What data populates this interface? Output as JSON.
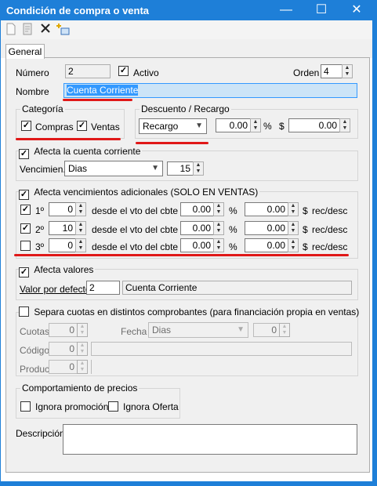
{
  "window": {
    "title": "Condición de compra o venta",
    "minimize": "—",
    "maximize": "☐",
    "close": "✕"
  },
  "toolbar": {
    "icons": [
      "new-doc-icon",
      "edit-doc-icon",
      "delete-icon",
      "add-field-icon"
    ]
  },
  "tabs": [
    {
      "label": "General"
    }
  ],
  "form": {
    "numero_label": "Número",
    "numero_value": "2",
    "activo_label": "Activo",
    "activo_checked": true,
    "orden_label": "Orden",
    "orden_value": "4",
    "nombre_label": "Nombre",
    "nombre_value": "Cuenta Corriente",
    "categoria": {
      "title": "Categoría",
      "compras_label": "Compras",
      "compras_checked": true,
      "ventas_label": "Ventas",
      "ventas_checked": true
    },
    "descuento": {
      "title": "Descuento / Recargo",
      "tipo": "Recargo",
      "porcentaje": "0.00",
      "pct_symbol": "%",
      "currency_symbol": "$",
      "monto": "0.00"
    },
    "afecta_cc": {
      "label": "Afecta la cuenta corriente",
      "checked": true,
      "venc_label": "Vencimien.",
      "venc_unit": "Dias",
      "venc_value": "15"
    },
    "vencimientos": {
      "label": "Afecta vencimientos adicionales (SOLO EN VENTAS)",
      "checked": true,
      "rows": [
        {
          "ord": "1º",
          "checked": true,
          "dias": "0",
          "desde": "desde el vto del cbte",
          "pct": "0.00",
          "pct_symbol": "%",
          "monto": "0.00",
          "currency_symbol": "$",
          "tipo": "rec/desc"
        },
        {
          "ord": "2º",
          "checked": true,
          "dias": "10",
          "desde": "desde el vto del cbte",
          "pct": "0.00",
          "pct_symbol": "%",
          "monto": "0.00",
          "currency_symbol": "$",
          "tipo": "rec/desc"
        },
        {
          "ord": "3º",
          "checked": false,
          "dias": "0",
          "desde": "desde el vto del cbte",
          "pct": "0.00",
          "pct_symbol": "%",
          "monto": "0.00",
          "currency_symbol": "$",
          "tipo": "rec/desc"
        }
      ]
    },
    "afecta_valores": {
      "label": "Afecta valores",
      "checked": true,
      "valor_label": "Valor por defecto",
      "valor_code": "2",
      "valor_name": "Cuenta Corriente"
    },
    "cuotas": {
      "label": "Separa cuotas en distintos comprobantes (para financiación propia en ventas)",
      "checked": false,
      "cuotas_label": "Cuotas",
      "cuotas_value": "0",
      "fecha_label": "Fecha",
      "fecha_unit": "Dias",
      "fecha_value": "0",
      "codigo_label": "Código",
      "codigo_value": "0",
      "produc_label": "Produc.",
      "produc_value": "0"
    },
    "precios": {
      "title": "Comportamiento de precios",
      "ignora_promo_label": "Ignora promoción",
      "ignora_promo_checked": false,
      "ignora_oferta_label": "Ignora Oferta",
      "ignora_oferta_checked": false
    },
    "descripcion_label": "Descripción",
    "descripcion_value": ""
  },
  "colors": {
    "title_bar": "#1e7fd8",
    "selection": "#3399ff",
    "highlight_field": "#cce4f7",
    "annotation": "#e01818"
  }
}
